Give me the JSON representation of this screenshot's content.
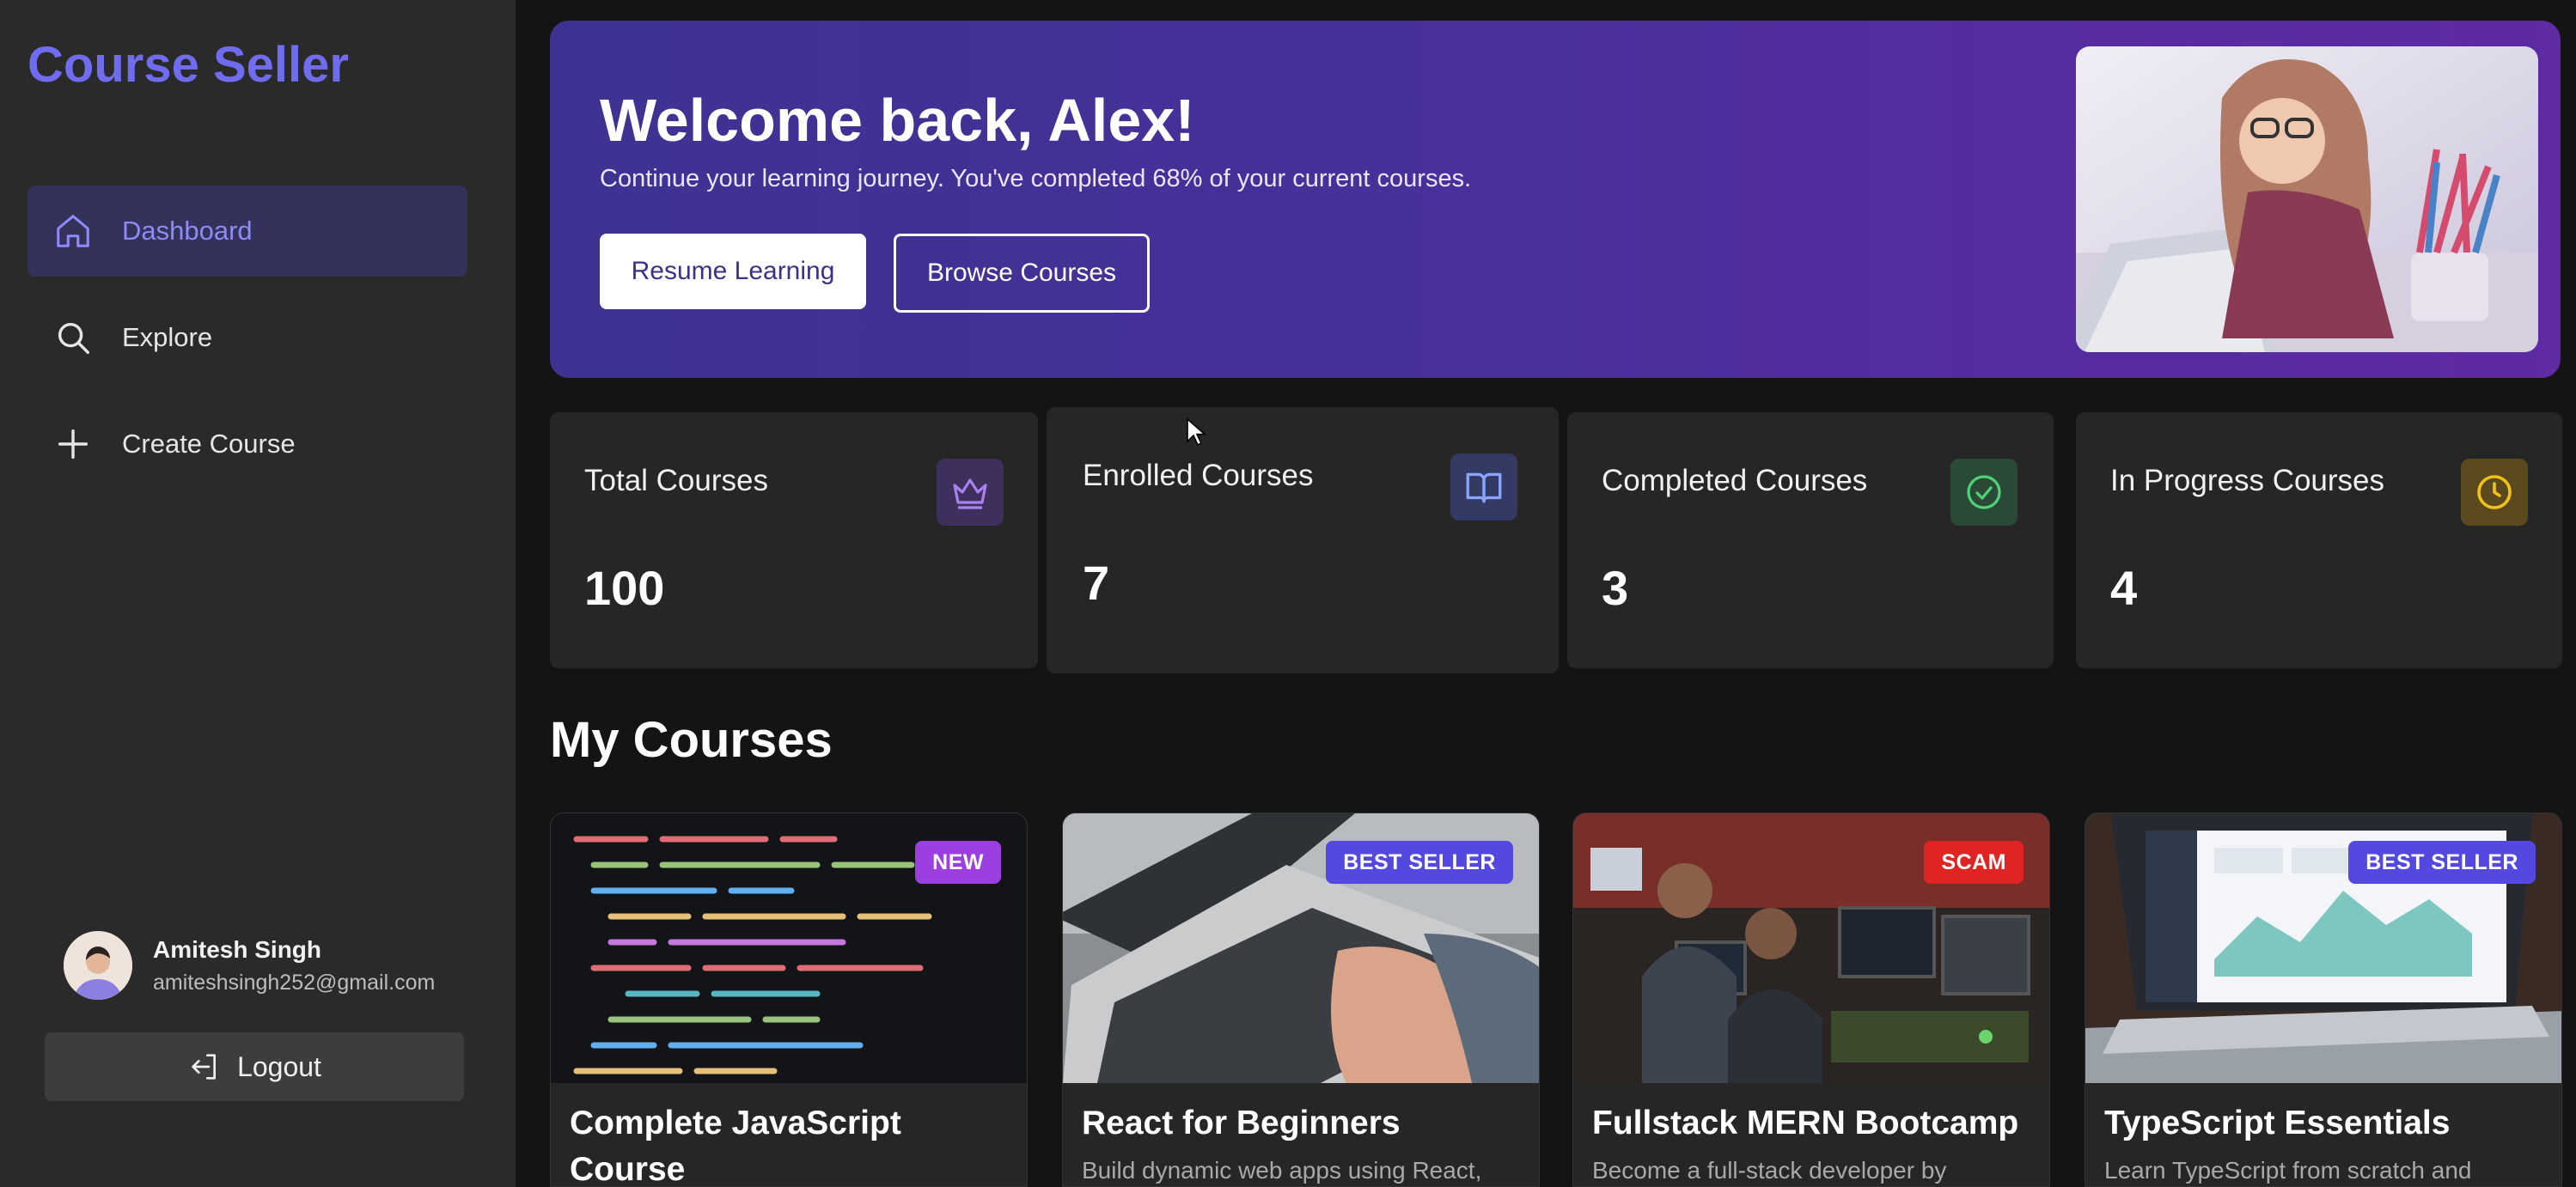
{
  "sidebar": {
    "brand": "Course Seller",
    "nav": [
      {
        "label": "Dashboard",
        "icon": "home-icon",
        "active": true
      },
      {
        "label": "Explore",
        "icon": "search-icon",
        "active": false
      },
      {
        "label": "Create Course",
        "icon": "plus-icon",
        "active": false
      }
    ],
    "user": {
      "name": "Amitesh Singh",
      "email": "amiteshsingh252@gmail.com"
    },
    "logout_label": "Logout"
  },
  "hero": {
    "title": "Welcome back, Alex!",
    "subtitle": "Continue your learning journey. You've completed 68% of your current courses.",
    "resume_label": "Resume Learning",
    "browse_label": "Browse Courses"
  },
  "stats": [
    {
      "label": "Total Courses",
      "value": "100",
      "icon": "crown-icon",
      "color": "#a880f0"
    },
    {
      "label": "Enrolled Courses",
      "value": "7",
      "icon": "book-open-icon",
      "color": "#8aa4ff"
    },
    {
      "label": "Completed Courses",
      "value": "3",
      "icon": "check-circle-icon",
      "color": "#4fd37a"
    },
    {
      "label": "In Progress Courses",
      "value": "4",
      "icon": "clock-icon",
      "color": "#f2c21b"
    }
  ],
  "courses_section": {
    "title": "My Courses",
    "courses": [
      {
        "title": "Complete JavaScript Course",
        "description": "",
        "badge": "NEW",
        "badge_color": "#9b3fe0"
      },
      {
        "title": "React for Beginners",
        "description": "Build dynamic web apps using React,",
        "badge": "BEST SELLER",
        "badge_color": "#5348e0"
      },
      {
        "title": "Fullstack MERN Bootcamp",
        "description": "Become a full-stack developer by",
        "badge": "SCAM",
        "badge_color": "#e02424"
      },
      {
        "title": "TypeScript Essentials",
        "description": "Learn TypeScript from scratch and",
        "badge": "BEST SELLER",
        "badge_color": "#5348e0"
      }
    ]
  }
}
